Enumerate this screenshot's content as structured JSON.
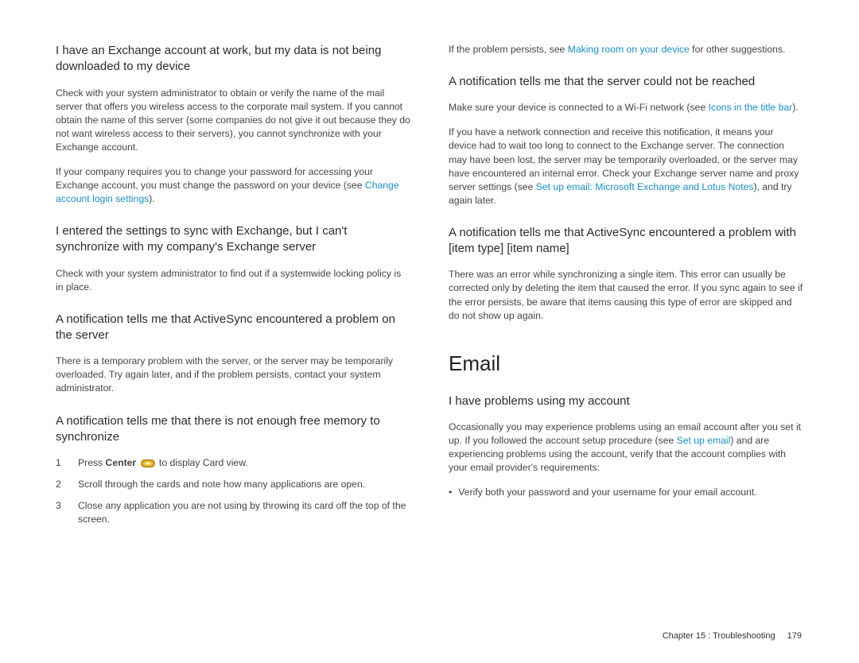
{
  "left": {
    "h1": "I have an Exchange account at work, but my data is not being downloaded to my device",
    "p1": "Check with your system administrator to obtain or verify the name of the mail server that offers you wireless access to the corporate mail system. If you cannot obtain the name of this server (some companies do not give it out because they do not want wireless access to their servers), you cannot synchronize with your Exchange account.",
    "p2a": "If your company requires you to change your password for accessing your Exchange account, you must change the password on your device (see ",
    "p2link": "Change account login settings",
    "p2b": ").",
    "h2": "I entered the settings to sync with Exchange, but I can't synchronize with my company's Exchange server",
    "p3": "Check with your system administrator to find out if a systemwide locking policy is in place.",
    "h3": "A notification tells me that ActiveSync encountered a problem on the server",
    "p4": "There is a temporary problem with the server, or the server may be temporarily overloaded. Try again later, and if the problem persists, contact your system administrator.",
    "h4": "A notification tells me that there is not enough free memory to synchronize",
    "steps": [
      {
        "num": "1",
        "pre": "Press ",
        "bold": "Center",
        "post": " to display Card view.",
        "icon": true
      },
      {
        "num": "2",
        "text": "Scroll through the cards and note how many applications are open."
      },
      {
        "num": "3",
        "text": "Close any application you are not using by throwing its card off the top of the screen."
      }
    ]
  },
  "right": {
    "p0a": "If the problem persists, see ",
    "p0link": "Making room on your device",
    "p0b": " for other suggestions.",
    "h1": "A notification tells me that the server could not be reached",
    "p1a": "Make sure your device is connected to a Wi-Fi network (see ",
    "p1link": "Icons in the title bar",
    "p1b": ").",
    "p2a": "If you have a network connection and receive this notification, it means your device had to wait too long to connect to the Exchange server. The connection may have been lost, the server may be temporarily overloaded, or the server may have encountered an internal error. Check your Exchange server name and proxy server settings (see ",
    "p2link": "Set up email: Microsoft Exchange and Lotus Notes",
    "p2b": "), and try again later.",
    "h2": "A notification tells me that ActiveSync encountered a problem with [item type] [item name]",
    "p3": "There was an error while synchronizing a single item. This error can usually be corrected only by deleting the item that caused the error. If you sync again to see if the error persists, be aware that items causing this type of error are skipped and do not show up again.",
    "section": "Email",
    "h3": "I have problems using my account",
    "p4a": "Occasionally you may experience problems using an email account after you set it up. If you followed the account setup procedure (see ",
    "p4link": "Set up email",
    "p4b": ") and are experiencing problems using the account, verify that the account complies with your email provider's requirements:",
    "bullet1": "Verify both your password and your username for your email account."
  },
  "footer": {
    "chapter": "Chapter 15 : Troubleshooting",
    "page": "179"
  }
}
